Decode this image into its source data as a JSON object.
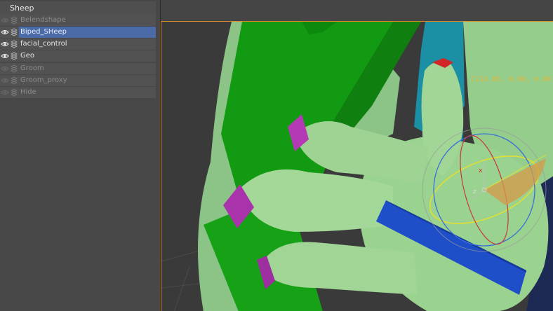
{
  "layers_panel": {
    "title": "Sheep",
    "rows": [
      {
        "name": "Belendshape",
        "visible": false,
        "selected": false
      },
      {
        "name": "Biped_SHeep",
        "visible": true,
        "selected": true
      },
      {
        "name": "facial_control",
        "visible": true,
        "selected": false
      },
      {
        "name": "Geo",
        "visible": true,
        "selected": false
      },
      {
        "name": "Groom",
        "visible": false,
        "selected": false
      },
      {
        "name": "Groom_proxy",
        "visible": false,
        "selected": false
      },
      {
        "name": "Hide",
        "visible": false,
        "selected": false
      }
    ]
  },
  "viewport": {
    "transform_readout": "[113.85, 0.00, 0.00]",
    "gizmo_axes": {
      "x": "x",
      "z": "z"
    },
    "colors": {
      "frame_border": "#d98b2b",
      "skin": "#8fc987",
      "clothing": "#159c15",
      "nails": "#b23bb3",
      "bone": "#1f4fc8",
      "readout": "#e5b53a"
    }
  }
}
